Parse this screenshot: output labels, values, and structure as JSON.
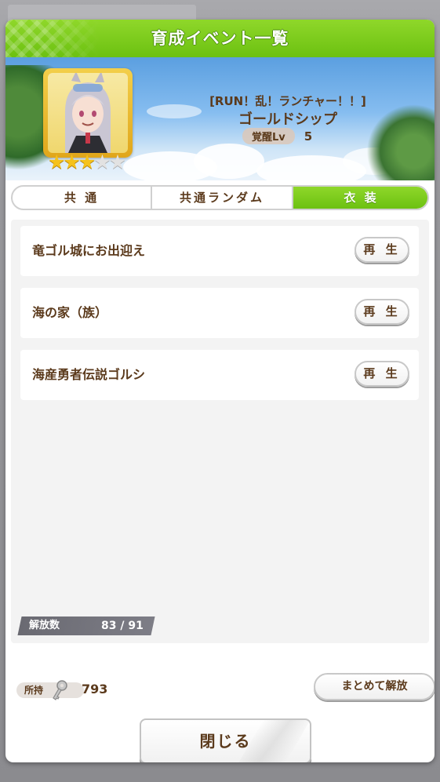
{
  "dialog": {
    "title": "育成イベント一覧"
  },
  "character": {
    "outfit": "[RUN！乱！ランチャー！！]",
    "name": "ゴールドシップ",
    "awakening_label": "覚醒Lv",
    "awakening_level": "5",
    "stars_filled": 3,
    "stars_total": 5
  },
  "tabs": [
    {
      "label": "共 通",
      "active": false
    },
    {
      "label": "共通ランダム",
      "active": false
    },
    {
      "label": "衣 装",
      "active": true
    }
  ],
  "events": [
    {
      "title": "竜ゴル城にお出迎え",
      "button": "再 生"
    },
    {
      "title": "海の家（族）",
      "button": "再 生"
    },
    {
      "title": "海産勇者伝説ゴルシ",
      "button": "再 生"
    }
  ],
  "unlock": {
    "label": "解放数",
    "value": "83 /  91"
  },
  "owned": {
    "label": "所持",
    "value": "793",
    "icon": "key-icon"
  },
  "buttons": {
    "bulk_unlock": "まとめて解放",
    "close": "閉じる"
  },
  "colors": {
    "accent_green": "#7ccc1a",
    "text_brown": "#5b3a1c",
    "star_gold": "#f5c21b"
  }
}
